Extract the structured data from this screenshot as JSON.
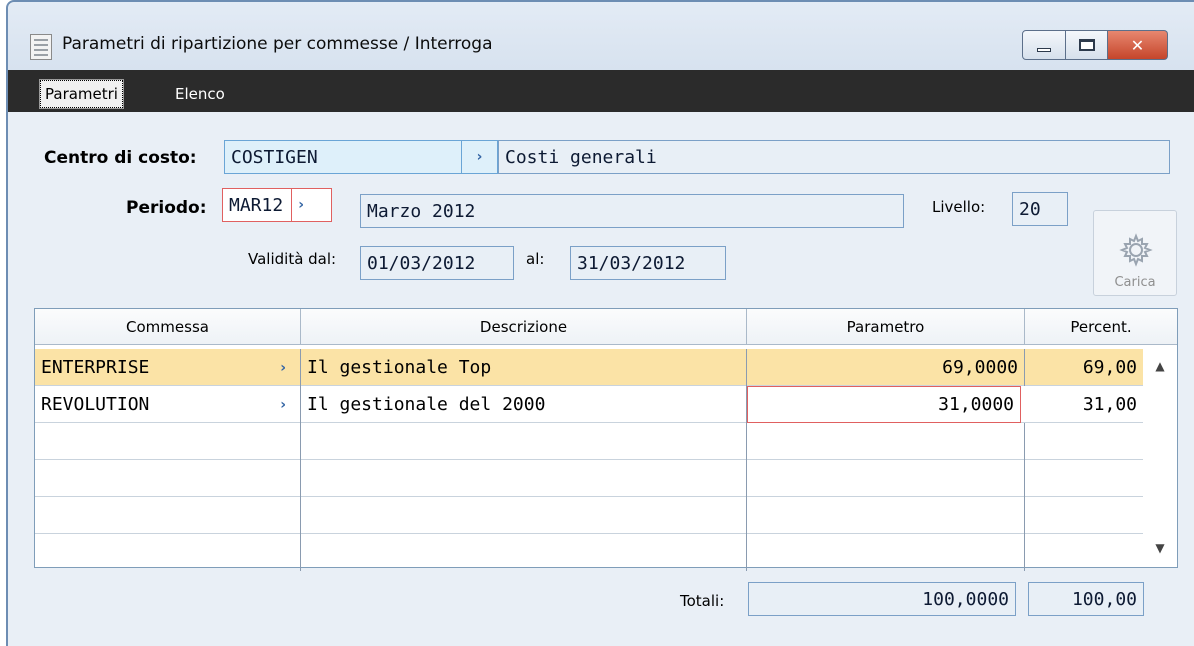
{
  "window": {
    "title": "Parametri di ripartizione per commesse / Interroga",
    "controls": {
      "minimize": "",
      "maximize": "",
      "close": "✕"
    }
  },
  "tabs": [
    {
      "label": "Parametri",
      "active": true
    },
    {
      "label": "Elenco",
      "active": false
    }
  ],
  "form": {
    "centro_costo": {
      "label": "Centro di costo:",
      "code": "COSTIGEN",
      "description": "Costi generali"
    },
    "periodo": {
      "label": "Periodo:",
      "code": "MAR12",
      "description": "Marzo 2012"
    },
    "livello": {
      "label": "Livello:",
      "value": "20"
    },
    "validita": {
      "label_dal": "Validità dal:",
      "dal": "01/03/2012",
      "label_al": "al:",
      "al": "31/03/2012"
    },
    "zoom_glyph": "›"
  },
  "carica_button": {
    "label": "Carica",
    "icon": "gear-icon"
  },
  "grid": {
    "columns": [
      "Commessa",
      "Descrizione",
      "Parametro",
      "Percent."
    ],
    "rows": [
      {
        "commessa": "ENTERPRISE",
        "zoom": "›",
        "descrizione": "Il gestionale Top",
        "parametro": "69,0000",
        "percent": "69,00",
        "selected": true
      },
      {
        "commessa": "REVOLUTION",
        "zoom": "›",
        "descrizione": "Il gestionale del 2000",
        "parametro": "31,0000",
        "percent": "31,00",
        "selected": false
      }
    ],
    "scroll_up": "▲",
    "scroll_down": "▼"
  },
  "totali": {
    "label": "Totali:",
    "parametro": "100,0000",
    "percent": "100,00"
  },
  "colors": {
    "window_bg": "#e9eff6",
    "tabbar_bg": "#2b2b2b",
    "selected_row": "#fbe3a6",
    "required_border": "#e06060",
    "zoom_arrow": "#3465a4"
  }
}
